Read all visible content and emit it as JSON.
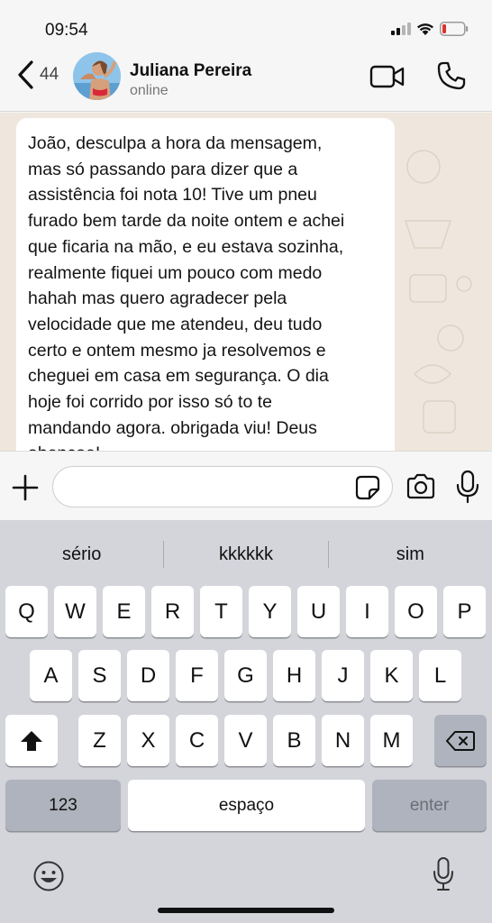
{
  "status_bar": {
    "time": "09:54"
  },
  "header": {
    "back_count": "44",
    "contact_name": "Juliana Pereira",
    "contact_status": "online"
  },
  "chat": {
    "message_lines": [
      "João, desculpa a hora da mensagem,",
      "mas só passando para dizer que a",
      "assistência foi nota 10! Tive um pneu",
      "furado bem tarde da noite ontem e achei",
      "que ficaria na mão, e eu estava sozinha,",
      "realmente fiquei um pouco com medo",
      "hahah mas quero agradecer pela",
      "velocidade que me atendeu, deu tudo",
      "certo e ontem mesmo ja resolvemos e",
      "cheguei em casa em segurança. O dia",
      "hoje foi corrido por isso só to te",
      "mandando agora. obrigada viu! Deus",
      "abençoe!"
    ]
  },
  "input_bar": {
    "value": "",
    "placeholder": ""
  },
  "keyboard": {
    "suggestions": [
      "sério",
      "kkkkkk",
      "sim"
    ],
    "row1": [
      "Q",
      "W",
      "E",
      "R",
      "T",
      "Y",
      "U",
      "I",
      "O",
      "P"
    ],
    "row2": [
      "A",
      "S",
      "D",
      "F",
      "G",
      "H",
      "J",
      "K",
      "L"
    ],
    "row3": [
      "Z",
      "X",
      "C",
      "V",
      "B",
      "N",
      "M"
    ],
    "numbers_label": "123",
    "space_label": "espaço",
    "enter_label": "enter"
  },
  "icons": {
    "back": "chevron-left-icon",
    "video": "video-camera-icon",
    "call": "phone-icon",
    "plus": "plus-icon",
    "sticker": "sticker-icon",
    "camera": "camera-icon",
    "mic": "microphone-icon",
    "shift": "shift-icon",
    "backspace": "backspace-icon",
    "emoji": "emoji-icon",
    "dictation": "dictation-microphone-icon"
  },
  "colors": {
    "chat_background": "#efe7dd",
    "bubble": "#ffffff",
    "keyboard": "#d3d5db",
    "battery_low": "#e0302b"
  }
}
